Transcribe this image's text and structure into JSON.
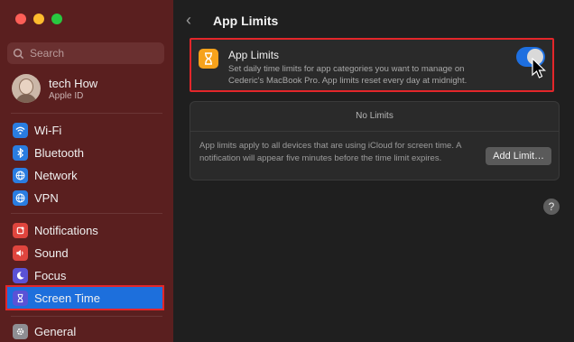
{
  "sidebar": {
    "search_placeholder": "Search",
    "user": {
      "name": "tech How",
      "subtitle": "Apple ID"
    },
    "items": [
      {
        "label": "Wi-Fi",
        "icon": "wifi-icon",
        "color": "#2a7de1"
      },
      {
        "label": "Bluetooth",
        "icon": "bluetooth-icon",
        "color": "#2a7de1"
      },
      {
        "label": "Network",
        "icon": "globe-icon",
        "color": "#2a7de1"
      },
      {
        "label": "VPN",
        "icon": "vpn-globe-icon",
        "color": "#2a7de1"
      },
      {
        "label": "Notifications",
        "icon": "bell-icon",
        "color": "#e0453e"
      },
      {
        "label": "Sound",
        "icon": "speaker-icon",
        "color": "#e0453e"
      },
      {
        "label": "Focus",
        "icon": "moon-icon",
        "color": "#5a52d6"
      },
      {
        "label": "Screen Time",
        "icon": "hourglass-icon",
        "color": "#5a52d6"
      },
      {
        "label": "General",
        "icon": "gear-icon",
        "color": "#8e8e93"
      }
    ]
  },
  "header": {
    "title": "App Limits"
  },
  "app_limits_card": {
    "title": "App Limits",
    "description": "Set daily time limits for app categories you want to manage on Cederic's MacBook Pro. App limits reset every day at midnight.",
    "toggle_on": true
  },
  "limits_card": {
    "empty_text": "No Limits",
    "description": "App limits apply to all devices that are using iCloud for screen time. A notification will appear five minutes before the time limit expires.",
    "add_button": "Add Limit…"
  },
  "help_label": "?",
  "colors": {
    "accent": "#1e6fe0",
    "highlight_border": "#e3262a",
    "sidebar_bg": "#5a1f1f"
  }
}
